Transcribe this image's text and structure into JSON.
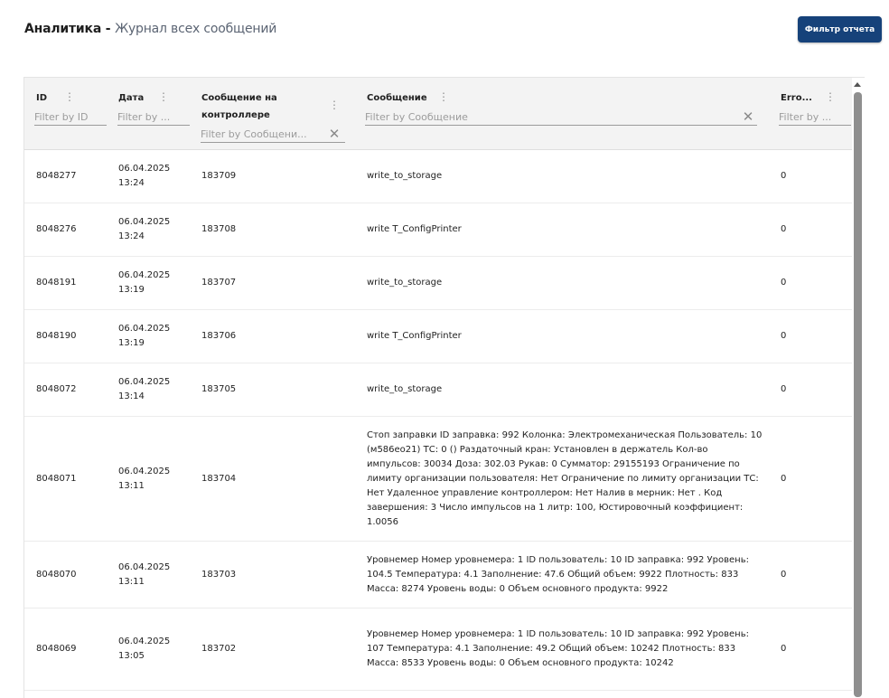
{
  "page": {
    "title_main": "Аналитика - ",
    "title_crumb": "Журнал всех сообщений",
    "filter_button": "Фильтр отчета"
  },
  "grid": {
    "columns": [
      {
        "key": "id",
        "label": "ID",
        "filter_placeholder": "Filter by ID"
      },
      {
        "key": "date",
        "label": "Дата",
        "filter_placeholder": "Filter by ..."
      },
      {
        "key": "ctl",
        "label": "Сообщение на контроллере",
        "filter_placeholder": "Filter by Сообщени..."
      },
      {
        "key": "msg",
        "label": "Сообщение",
        "filter_placeholder": "Filter by Сообщение"
      },
      {
        "key": "err",
        "label": "Erro...",
        "filter_placeholder": "Filter by ..."
      }
    ],
    "rows": [
      {
        "id": "8048277",
        "date": "06.04.2025 13:24",
        "ctl": "183709",
        "msg": "write_to_storage",
        "err": "0"
      },
      {
        "id": "8048276",
        "date": "06.04.2025 13:24",
        "ctl": "183708",
        "msg": "write T_ConfigPrinter",
        "err": "0"
      },
      {
        "id": "8048191",
        "date": "06.04.2025 13:19",
        "ctl": "183707",
        "msg": "write_to_storage",
        "err": "0"
      },
      {
        "id": "8048190",
        "date": "06.04.2025 13:19",
        "ctl": "183706",
        "msg": "write T_ConfigPrinter",
        "err": "0"
      },
      {
        "id": "8048072",
        "date": "06.04.2025 13:14",
        "ctl": "183705",
        "msg": "write_to_storage",
        "err": "0"
      },
      {
        "id": "8048071",
        "date": "06.04.2025 13:11",
        "ctl": "183704",
        "msg": "Стоп заправки ID заправка: 992 Колонка: Электромеханическая Пользователь: 10 (м586ео21) ТС: 0 () Раздаточный кран: Установлен в держатель Кол-во импульсов: 30034 Доза: 302.03 Рукав: 0 Сумматор: 29155193 Ограничение по лимиту организации пользователя: Нет Ограничение по лимиту организации ТС: Нет Удаленное управление контроллером: Нет Налив в мерник: Нет . Код завершения: 3 Число импульсов на 1 литр: 100, Юстировочный коэффициент: 1.0056",
        "err": "0"
      },
      {
        "id": "8048070",
        "date": "06.04.2025 13:11",
        "ctl": "183703",
        "msg": "Уровнемер Номер уровнемера: 1 ID пользователь: 10 ID заправка: 992 Уровень: 104.5 Температура: 4.1 Заполнение: 47.6 Общий объем: 9922 Плотность: 833 Масса: 8274 Уровень воды: 0 Объем основного продукта: 9922",
        "err": "0"
      },
      {
        "id": "8048069",
        "date": "06.04.2025 13:05",
        "ctl": "183702",
        "msg": "Уровнемер Номер уровнемера: 1 ID пользователь: 10 ID заправка: 992 Уровень: 107 Температура: 4.1 Заполнение: 49.2 Общий объем: 10242 Плотность: 833 Масса: 8533 Уровень воды: 0 Объем основного продукта: 10242",
        "err": "0"
      }
    ]
  }
}
